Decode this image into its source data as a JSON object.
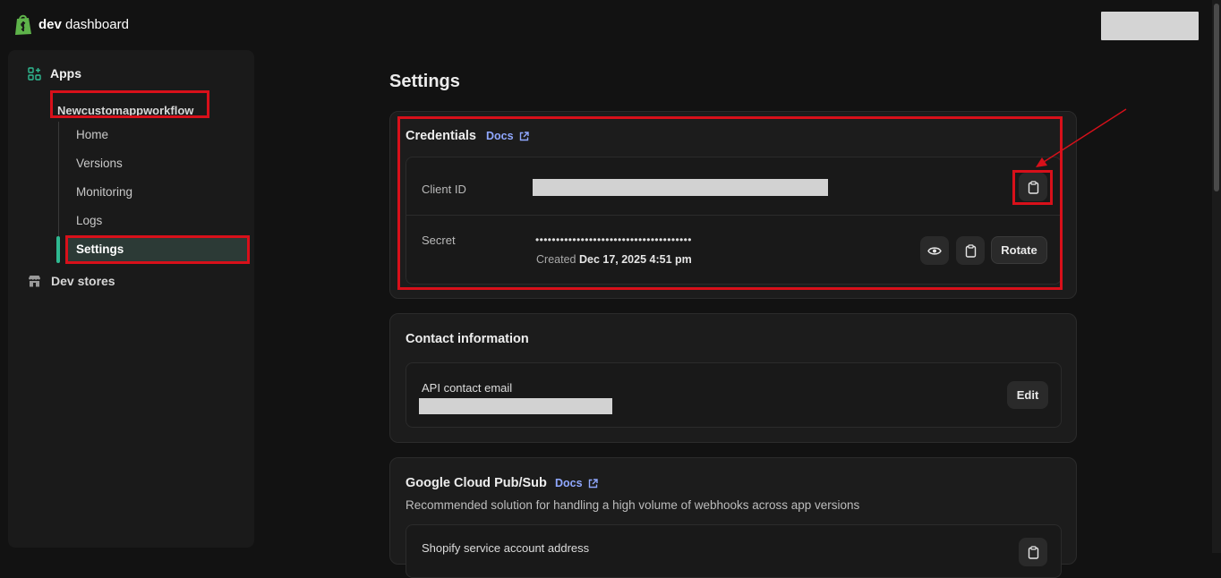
{
  "header": {
    "logo_bold": "dev",
    "logo_rest": " dashboard"
  },
  "sidebar": {
    "apps_label": "Apps",
    "app_name": "Newcustomappworkflow",
    "sub_items": [
      "Home",
      "Versions",
      "Monitoring",
      "Logs"
    ],
    "active_item": "Settings",
    "dev_stores_label": "Dev stores"
  },
  "main": {
    "page_title": "Settings",
    "credentials": {
      "title": "Credentials",
      "docs": "Docs",
      "client_id_label": "Client ID",
      "secret_label": "Secret",
      "secret_masked": "••••••••••••••••••••••••••••••••••••••",
      "created_prefix": "Created",
      "created_date": "Dec 17, 2025 4:51 pm",
      "rotate_label": "Rotate"
    },
    "contact": {
      "title": "Contact information",
      "api_email_label": "API contact email",
      "edit_label": "Edit"
    },
    "pubsub": {
      "title": "Google Cloud Pub/Sub",
      "docs": "Docs",
      "description": "Recommended solution for handling a high volume of webhooks across app versions",
      "service_account_label": "Shopify service account address"
    }
  },
  "colors": {
    "accent_green": "#2fb991",
    "highlight_red": "#d8101a",
    "link_blue": "#90a8ff"
  },
  "icons": [
    "shopify-bag-icon",
    "apps-grid-icon",
    "store-icon",
    "external-link-icon",
    "clipboard-icon",
    "eye-icon"
  ]
}
